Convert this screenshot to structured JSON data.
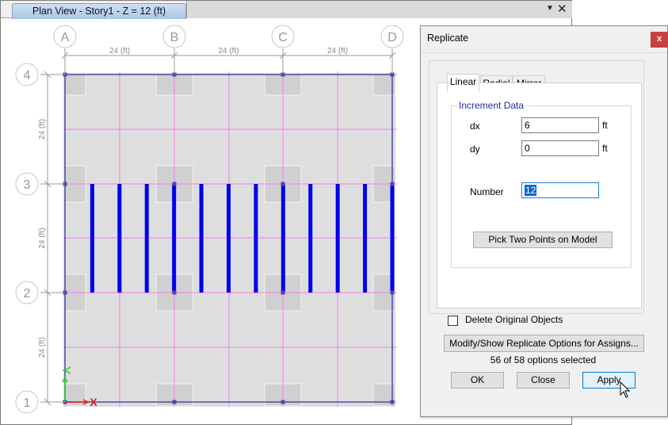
{
  "plan_view": {
    "tab_title": "Plan View - Story1 - Z = 12 (ft)",
    "dropdown_icon": "triangle-down-icon",
    "close_icon": "close-icon",
    "grid_x": [
      "A",
      "B",
      "C",
      "D"
    ],
    "grid_y": [
      "4",
      "3",
      "2",
      "1"
    ],
    "dim_x": [
      "24 (ft)",
      "24 (ft)",
      "24 (ft)"
    ],
    "dim_y": [
      "24 (ft)",
      "24 (ft)",
      "24 (ft)"
    ],
    "axis_x_label": "X",
    "axis_y_label": "Y",
    "beam_count": 12,
    "colors": {
      "slab": "#dedede",
      "column_pad": "#d0d0d0",
      "gridline": "#f080f0",
      "frame_line": "#4a4aa8",
      "beam": "#0000ee",
      "axis_x": "#e02020",
      "axis_y": "#20d020",
      "bubble": "#c8c8c8",
      "dimension": "#9a9a9a"
    }
  },
  "dialog": {
    "title": "Replicate",
    "close_label": "x",
    "tabs": [
      {
        "label": "Linear",
        "active": true
      },
      {
        "label": "Radial",
        "active": false
      },
      {
        "label": "Mirror",
        "active": false
      }
    ],
    "group_label": "Increment Data",
    "dx": {
      "label": "dx",
      "value": "6",
      "unit": "ft"
    },
    "dy": {
      "label": "dy",
      "value": "0",
      "unit": "ft"
    },
    "number": {
      "label": "Number",
      "value": "12"
    },
    "pick_button": "Pick Two Points on Model",
    "delete_original": {
      "label": "Delete Original Objects",
      "checked": false
    },
    "modify_button": "Modify/Show Replicate Options for Assigns...",
    "options_count": "56 of 58 options selected",
    "ok_button": "OK",
    "close_button": "Close",
    "apply_button": "Apply"
  }
}
